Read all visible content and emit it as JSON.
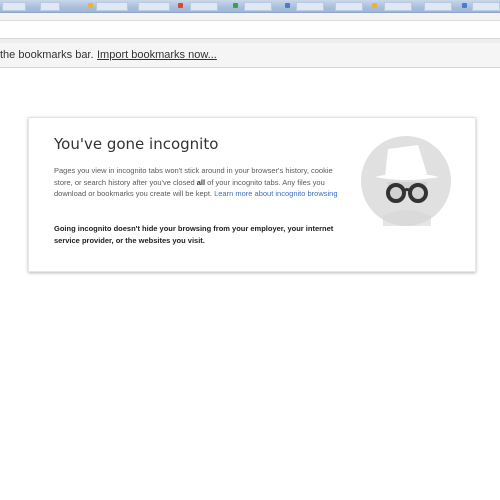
{
  "bookmarks_bar": {
    "message": "the bookmarks bar.",
    "import_link": "Import bookmarks now..."
  },
  "incognito": {
    "title": "You've gone incognito",
    "body_part1": "Pages you view in incognito tabs won't stick around in your browser's history, cookie store, or search history after you've closed ",
    "body_bold": "all",
    "body_part2": " of your incognito tabs. Any files you download or bookmarks you create will be kept. ",
    "learn_more": "Learn more about incognito browsing",
    "warning": "Going incognito doesn't hide your browsing from your employer, your internet service provider, or the websites you visit.",
    "icon": "incognito-spy-icon"
  },
  "colors": {
    "link": "#3c6fc6",
    "icon_circle": "#e0e0e0",
    "icon_dark": "#333333"
  }
}
